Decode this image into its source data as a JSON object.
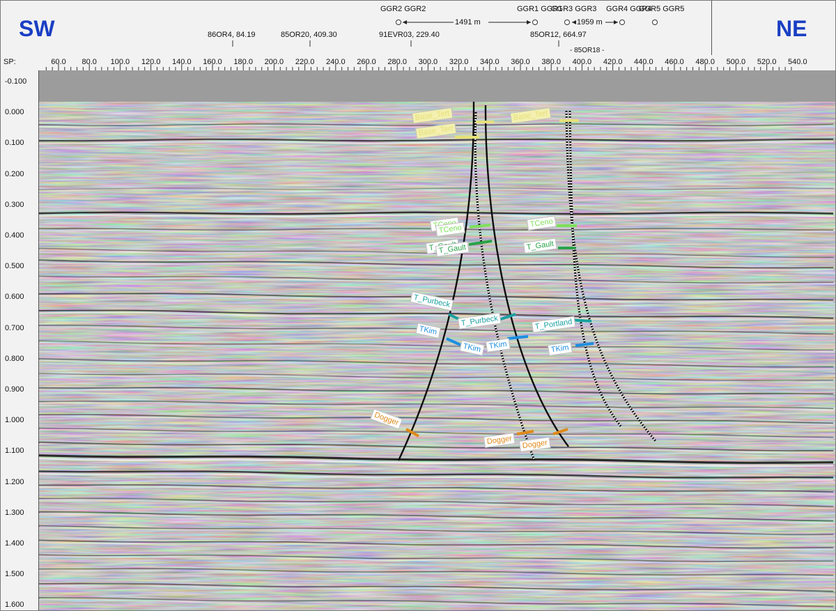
{
  "header": {
    "left_direction": "SW",
    "right_direction": "NE",
    "sp_label": "SP:",
    "sp_ticks": [
      "60.0",
      "80.0",
      "100.0",
      "120.0",
      "140.0",
      "160.0",
      "180.0",
      "200.0",
      "220.0",
      "240.0",
      "260.0",
      "280.0",
      "300.0",
      "320.0",
      "340.0",
      "360.0",
      "380.0",
      "400.0",
      "420.0",
      "440.0",
      "460.0",
      "480.0",
      "500.0",
      "520.0",
      "540.0"
    ],
    "line_intersections": [
      "86OR4, 84.19",
      "85OR20, 409.30",
      "91EVR03, 229.40",
      "85OR12, 664.97",
      "- 85OR18 -"
    ],
    "wells": [
      "GGR2 GGR2",
      "GGR1 GGR1",
      "GGR3 GGR3",
      "GGR4 GGR4",
      "GGR5 GGR5"
    ],
    "distances": [
      "1491 m",
      "1959 m"
    ]
  },
  "time_axis": [
    "-0.100",
    "0.000",
    "0.100",
    "0.200",
    "0.300",
    "0.400",
    "0.500",
    "0.600",
    "0.700",
    "0.800",
    "0.900",
    "1.000",
    "1.100",
    "1.200",
    "1.300",
    "1.400",
    "1.500",
    "1.600"
  ],
  "markers": {
    "base_tert_1": "Base_Tert",
    "base_tert_2": "Base_Tert",
    "base_tert_3": "Base_Tert",
    "tceno_1": "TCeno",
    "tceno_2": "TCeno",
    "tceno_3": "TCeno",
    "tgault_1": "T_Gault",
    "tgault_2": "T_Gault",
    "tgault_3": "T_Gault",
    "tpurbeck_1": "T_Purbeck",
    "tpurbeck_2": "T_Purbeck",
    "tportland": "T_Portland",
    "tkim_1": "TKim",
    "tkim_2": "TKim",
    "tkim_3": "TKim",
    "tkim_4": "TKim",
    "dogger_1": "Dogger",
    "dogger_2": "Dogger",
    "dogger_3": "Dogger"
  },
  "colors": {
    "direction_text": "#1a3fc4",
    "base_tert_marker": "#e6e07a",
    "tceno_marker": "#7ee05a",
    "tgault_marker": "#2aa34a",
    "tpurbeck_marker": "#1aa0a0",
    "tkim_marker": "#1e8fe0",
    "dogger_marker": "#e0891a"
  }
}
